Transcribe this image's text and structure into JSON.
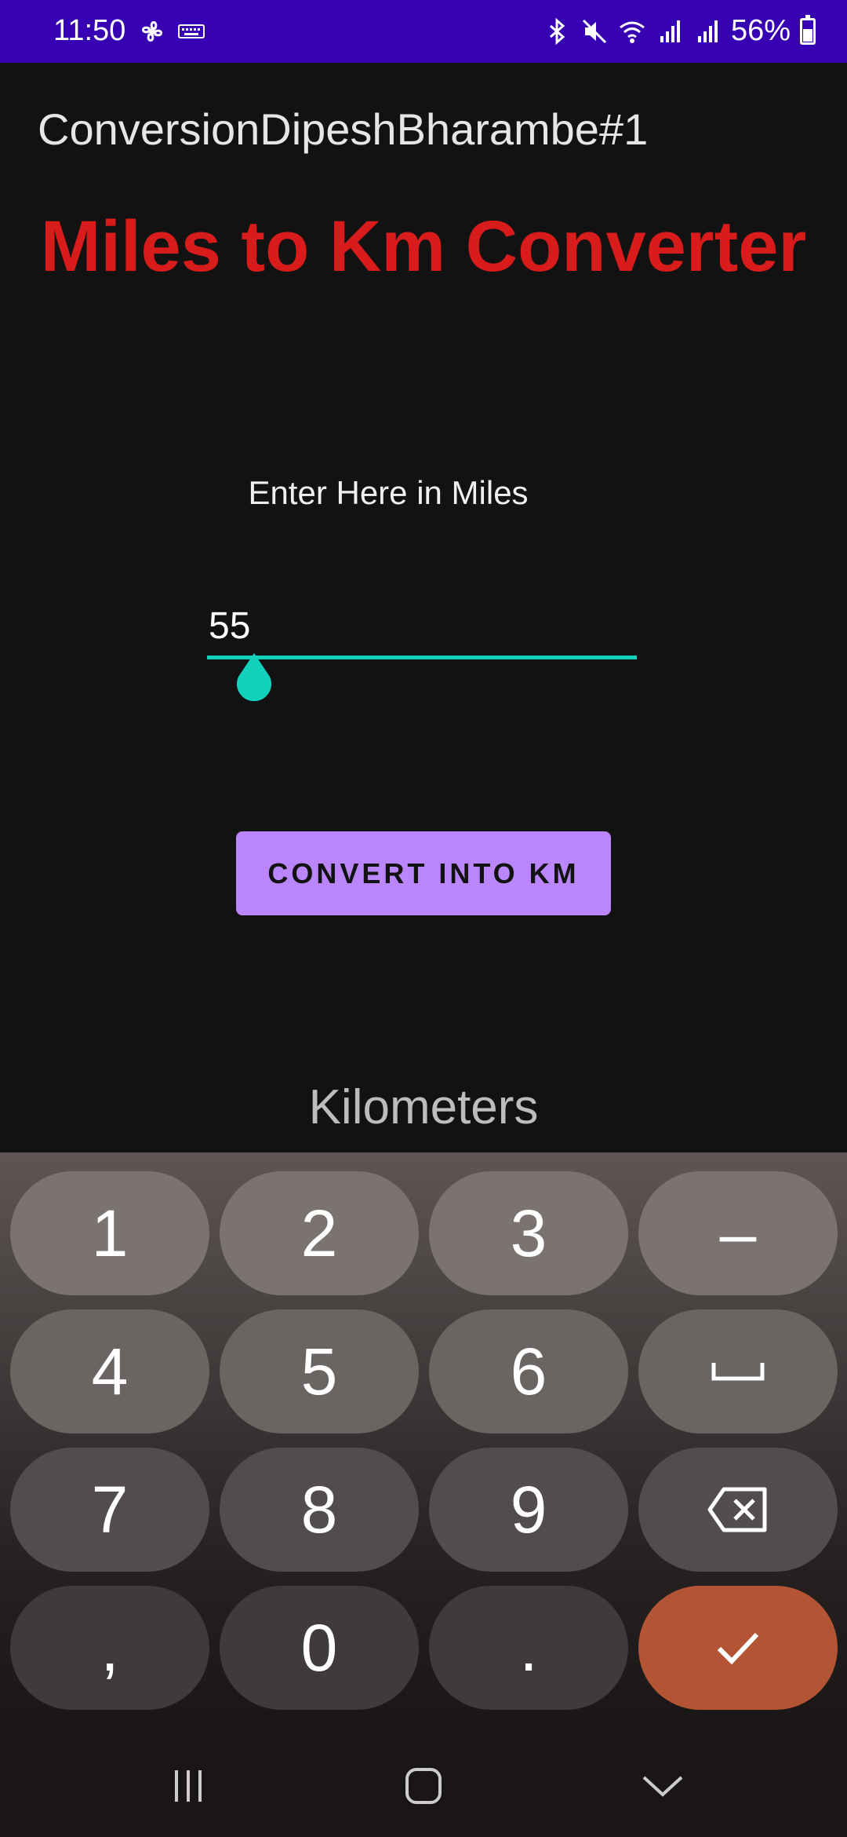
{
  "status_bar": {
    "time": "11:50",
    "battery": "56%",
    "left_icons": [
      "fan-icon",
      "keyboard-icon"
    ],
    "right_icons": [
      "bluetooth-icon",
      "mute-icon",
      "wifi-icon",
      "signal-icon",
      "signal-icon",
      "battery-icon"
    ],
    "background": "#3700b3"
  },
  "app": {
    "title": "ConversionDipeshBharambe#1",
    "heading": "Miles to Km Converter",
    "heading_color": "#d81b1b",
    "miles_label": "Enter Here in Miles",
    "miles_value": "55",
    "accent": "#11d3bc",
    "convert_button": "CONVERT INTO KM",
    "button_color": "#bb86fc",
    "result_label": "Kilometers"
  },
  "keyboard": {
    "rows": [
      [
        "1",
        "2",
        "3",
        "–"
      ],
      [
        "4",
        "5",
        "6",
        "space-icon"
      ],
      [
        "7",
        "8",
        "9",
        "backspace-icon"
      ],
      [
        ",",
        "0",
        ".",
        "check-icon"
      ]
    ],
    "done_color": "#b35535"
  },
  "navbar": {
    "items": [
      "recent-apps-icon",
      "home-icon",
      "back-icon"
    ]
  }
}
